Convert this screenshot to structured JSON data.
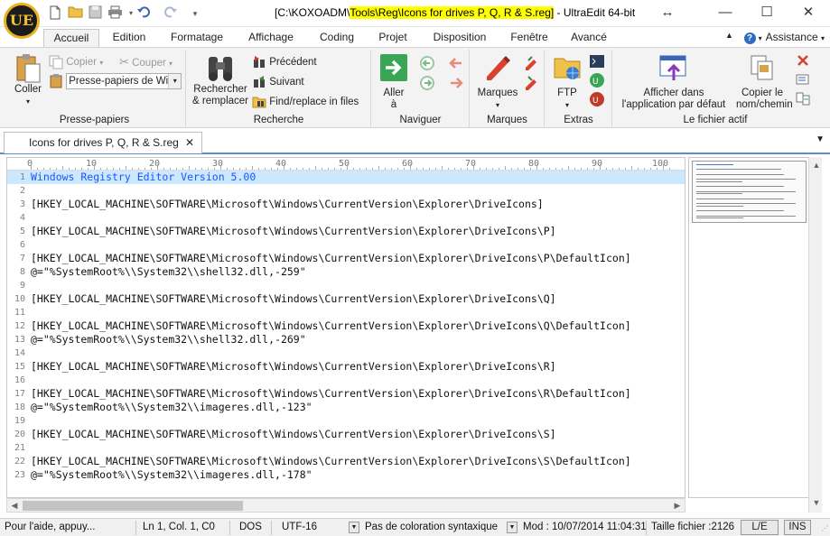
{
  "window": {
    "title_prefix": "[C:\\KOXOADM\\",
    "title_highlight": "Tools\\Reg\\Icons for drives P, Q, R & S.reg]",
    "title_suffix": " - UltraEdit 64-bit",
    "logo_text": "UE"
  },
  "ribbon_tabs": [
    "Accueil",
    "Edition",
    "Formatage",
    "Affichage",
    "Coding",
    "Projet",
    "Disposition",
    "Fenêtre",
    "Avancé"
  ],
  "assistance_label": "Assistance",
  "clipboard": {
    "paste_label": "Coller",
    "copy_label": "Copier",
    "cut_label": "Couper",
    "clipboard_select": "Presse-papiers de Wi",
    "group_label": "Presse-papiers"
  },
  "search": {
    "replace_label_1": "Rechercher",
    "replace_label_2": "& remplacer",
    "prev_label": "Précédent",
    "next_label": "Suivant",
    "findfiles_label": "Find/replace in files",
    "group_label": "Recherche"
  },
  "navigate": {
    "goto_label_1": "Aller",
    "goto_label_2": "à",
    "group_label": "Naviguer"
  },
  "marks": {
    "marks_label": "Marques",
    "group_label": "Marques"
  },
  "extras": {
    "ftp_label": "FTP",
    "group_label": "Extras"
  },
  "activefile": {
    "open_default_1": "Afficher dans",
    "open_default_2": "l'application par défaut",
    "copy_path_1": "Copier le",
    "copy_path_2": "nom/chemin",
    "group_label": "Le fichier actif"
  },
  "document_tab": {
    "label": "Icons for drives P, Q, R & S.reg"
  },
  "ruler_labels": [
    "0",
    "10",
    "20",
    "30",
    "40",
    "50",
    "60",
    "70",
    "80",
    "90",
    "100"
  ],
  "editor_lines": [
    {
      "n": "1",
      "t": "Windows Registry Editor Version 5.00"
    },
    {
      "n": "2",
      "t": ""
    },
    {
      "n": "3",
      "t": "[HKEY_LOCAL_MACHINE\\SOFTWARE\\Microsoft\\Windows\\CurrentVersion\\Explorer\\DriveIcons]"
    },
    {
      "n": "4",
      "t": ""
    },
    {
      "n": "5",
      "t": "[HKEY_LOCAL_MACHINE\\SOFTWARE\\Microsoft\\Windows\\CurrentVersion\\Explorer\\DriveIcons\\P]"
    },
    {
      "n": "6",
      "t": ""
    },
    {
      "n": "7",
      "t": "[HKEY_LOCAL_MACHINE\\SOFTWARE\\Microsoft\\Windows\\CurrentVersion\\Explorer\\DriveIcons\\P\\DefaultIcon]"
    },
    {
      "n": "8",
      "t": "@=\"%SystemRoot%\\\\System32\\\\shell32.dll,-259\""
    },
    {
      "n": "9",
      "t": ""
    },
    {
      "n": "10",
      "t": "[HKEY_LOCAL_MACHINE\\SOFTWARE\\Microsoft\\Windows\\CurrentVersion\\Explorer\\DriveIcons\\Q]"
    },
    {
      "n": "11",
      "t": ""
    },
    {
      "n": "12",
      "t": "[HKEY_LOCAL_MACHINE\\SOFTWARE\\Microsoft\\Windows\\CurrentVersion\\Explorer\\DriveIcons\\Q\\DefaultIcon]"
    },
    {
      "n": "13",
      "t": "@=\"%SystemRoot%\\\\System32\\\\shell32.dll,-269\""
    },
    {
      "n": "14",
      "t": ""
    },
    {
      "n": "15",
      "t": "[HKEY_LOCAL_MACHINE\\SOFTWARE\\Microsoft\\Windows\\CurrentVersion\\Explorer\\DriveIcons\\R]"
    },
    {
      "n": "16",
      "t": ""
    },
    {
      "n": "17",
      "t": "[HKEY_LOCAL_MACHINE\\SOFTWARE\\Microsoft\\Windows\\CurrentVersion\\Explorer\\DriveIcons\\R\\DefaultIcon]"
    },
    {
      "n": "18",
      "t": "@=\"%SystemRoot%\\\\System32\\\\imageres.dll,-123\""
    },
    {
      "n": "19",
      "t": ""
    },
    {
      "n": "20",
      "t": "[HKEY_LOCAL_MACHINE\\SOFTWARE\\Microsoft\\Windows\\CurrentVersion\\Explorer\\DriveIcons\\S]"
    },
    {
      "n": "21",
      "t": ""
    },
    {
      "n": "22",
      "t": "[HKEY_LOCAL_MACHINE\\SOFTWARE\\Microsoft\\Windows\\CurrentVersion\\Explorer\\DriveIcons\\S\\DefaultIcon]"
    },
    {
      "n": "23",
      "t": "@=\"%SystemRoot%\\\\System32\\\\imageres.dll,-178\""
    }
  ],
  "statusbar": {
    "help": "Pour l'aide, appuy...",
    "position": "Ln 1, Col. 1, C0",
    "line_ending": "DOS",
    "encoding": "UTF-16",
    "syntax": "Pas de coloration syntaxique",
    "modified": "Mod : 10/07/2014 11:04:31",
    "filesize": "Taille fichier :2126",
    "rw_mode": "L/E",
    "ins_mode": "INS"
  },
  "colors": {
    "accent": "#2b579a",
    "selection_line": "#cce8ff",
    "title_highlight": "#ffff00",
    "goto_green": "#3aa655",
    "marks_red": "#d9412e"
  }
}
